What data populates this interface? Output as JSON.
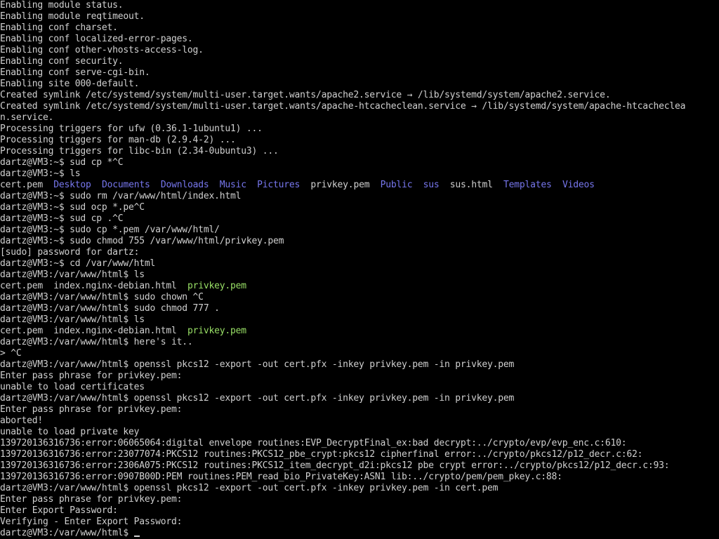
{
  "terminal": {
    "colors": {
      "background": "#000000",
      "text": "#d0d0d0",
      "directory": "#7777ee",
      "executable": "#99e066"
    },
    "prompt_cursor": "underscore",
    "lines": [
      [
        {
          "t": "Enabling module status.",
          "c": "default"
        }
      ],
      [
        {
          "t": "Enabling module reqtimeout.",
          "c": "default"
        }
      ],
      [
        {
          "t": "Enabling conf charset.",
          "c": "default"
        }
      ],
      [
        {
          "t": "Enabling conf localized-error-pages.",
          "c": "default"
        }
      ],
      [
        {
          "t": "Enabling conf other-vhosts-access-log.",
          "c": "default"
        }
      ],
      [
        {
          "t": "Enabling conf security.",
          "c": "default"
        }
      ],
      [
        {
          "t": "Enabling conf serve-cgi-bin.",
          "c": "default"
        }
      ],
      [
        {
          "t": "Enabling site 000-default.",
          "c": "default"
        }
      ],
      [
        {
          "t": "Created symlink /etc/systemd/system/multi-user.target.wants/apache2.service → /lib/systemd/system/apache2.service.",
          "c": "default"
        }
      ],
      [
        {
          "t": "Created symlink /etc/systemd/system/multi-user.target.wants/apache-htcacheclean.service → /lib/systemd/system/apache-htcachecleа",
          "c": "default"
        }
      ],
      [
        {
          "t": "n.service.",
          "c": "default"
        }
      ],
      [
        {
          "t": "Processing triggers for ufw (0.36.1-1ubuntu1) ...",
          "c": "default"
        }
      ],
      [
        {
          "t": "Processing triggers for man-db (2.9.4-2) ...",
          "c": "default"
        }
      ],
      [
        {
          "t": "Processing triggers for libc-bin (2.34-0ubuntu3) ...",
          "c": "default"
        }
      ],
      [
        {
          "t": "dartz@VM3:~$ sud cp *^C",
          "c": "default"
        }
      ],
      [
        {
          "t": "dartz@VM3:~$ ls",
          "c": "default"
        }
      ],
      [
        {
          "t": "cert.pem  ",
          "c": "default"
        },
        {
          "t": "Desktop",
          "c": "dir"
        },
        {
          "t": "  ",
          "c": "default"
        },
        {
          "t": "Documents",
          "c": "dir"
        },
        {
          "t": "  ",
          "c": "default"
        },
        {
          "t": "Downloads",
          "c": "dir"
        },
        {
          "t": "  ",
          "c": "default"
        },
        {
          "t": "Music",
          "c": "dir"
        },
        {
          "t": "  ",
          "c": "default"
        },
        {
          "t": "Pictures",
          "c": "dir"
        },
        {
          "t": "  privkey.pem  ",
          "c": "default"
        },
        {
          "t": "Public",
          "c": "dir"
        },
        {
          "t": "  ",
          "c": "default"
        },
        {
          "t": "sus",
          "c": "dir"
        },
        {
          "t": "  sus.html  ",
          "c": "default"
        },
        {
          "t": "Templates",
          "c": "dir"
        },
        {
          "t": "  ",
          "c": "default"
        },
        {
          "t": "Videos",
          "c": "dir"
        }
      ],
      [
        {
          "t": "dartz@VM3:~$ sudo rm /var/www/html/index.html",
          "c": "default"
        }
      ],
      [
        {
          "t": "dartz@VM3:~$ sud ocp *.pe^C",
          "c": "default"
        }
      ],
      [
        {
          "t": "dartz@VM3:~$ sud cp .^C",
          "c": "default"
        }
      ],
      [
        {
          "t": "dartz@VM3:~$ sudo cp *.pem /var/www/html/",
          "c": "default"
        }
      ],
      [
        {
          "t": "dartz@VM3:~$ sudo chmod 755 /var/www/html/privkey.pem",
          "c": "default"
        }
      ],
      [
        {
          "t": "[sudo] password for dartz:",
          "c": "default"
        }
      ],
      [
        {
          "t": "dartz@VM3:~$ cd /var/www/html",
          "c": "default"
        }
      ],
      [
        {
          "t": "dartz@VM3:/var/www/html$ ls",
          "c": "default"
        }
      ],
      [
        {
          "t": "cert.pem  index.nginx-debian.html  ",
          "c": "default"
        },
        {
          "t": "privkey.pem",
          "c": "exec"
        }
      ],
      [
        {
          "t": "dartz@VM3:/var/www/html$ sudo chown ^C",
          "c": "default"
        }
      ],
      [
        {
          "t": "dartz@VM3:/var/www/html$ sudo chmod 777 .",
          "c": "default"
        }
      ],
      [
        {
          "t": "dartz@VM3:/var/www/html$ ls",
          "c": "default"
        }
      ],
      [
        {
          "t": "cert.pem  index.nginx-debian.html  ",
          "c": "default"
        },
        {
          "t": "privkey.pem",
          "c": "exec"
        }
      ],
      [
        {
          "t": "dartz@VM3:/var/www/html$ here's it..",
          "c": "default"
        }
      ],
      [
        {
          "t": "> ^C",
          "c": "default"
        }
      ],
      [
        {
          "t": "dartz@VM3:/var/www/html$ openssl pkcs12 -export -out cert.pfx -inkey privkey.pem -in privkey.pem",
          "c": "default"
        }
      ],
      [
        {
          "t": "Enter pass phrase for privkey.pem:",
          "c": "default"
        }
      ],
      [
        {
          "t": "unable to load certificates",
          "c": "default"
        }
      ],
      [
        {
          "t": "dartz@VM3:/var/www/html$ openssl pkcs12 -export -out cert.pfx -inkey privkey.pem -in privkey.pem",
          "c": "default"
        }
      ],
      [
        {
          "t": "Enter pass phrase for privkey.pem:",
          "c": "default"
        }
      ],
      [
        {
          "t": "aborted!",
          "c": "default"
        }
      ],
      [
        {
          "t": "unable to load private key",
          "c": "default"
        }
      ],
      [
        {
          "t": "139720136316736:error:06065064:digital envelope routines:EVP_DecryptFinal_ex:bad decrypt:../crypto/evp/evp_enc.c:610:",
          "c": "default"
        }
      ],
      [
        {
          "t": "139720136316736:error:23077074:PKCS12 routines:PKCS12_pbe_crypt:pkcs12 cipherfinal error:../crypto/pkcs12/p12_decr.c:62:",
          "c": "default"
        }
      ],
      [
        {
          "t": "139720136316736:error:2306A075:PKCS12 routines:PKCS12_item_decrypt_d2i:pkcs12 pbe crypt error:../crypto/pkcs12/p12_decr.c:93:",
          "c": "default"
        }
      ],
      [
        {
          "t": "139720136316736:error:0907B00D:PEM routines:PEM_read_bio_PrivateKey:ASN1 lib:../crypto/pem/pem_pkey.c:88:",
          "c": "default"
        }
      ],
      [
        {
          "t": "dartz@VM3:/var/www/html$ openssl pkcs12 -export -out cert.pfx -inkey privkey.pem -in cert.pem",
          "c": "default"
        }
      ],
      [
        {
          "t": "Enter pass phrase for privkey.pem:",
          "c": "default"
        }
      ],
      [
        {
          "t": "Enter Export Password:",
          "c": "default"
        }
      ],
      [
        {
          "t": "Verifying - Enter Export Password:",
          "c": "default"
        }
      ],
      [
        {
          "t": "dartz@VM3:/var/www/html$ ",
          "c": "default",
          "cursor": true
        }
      ]
    ]
  }
}
